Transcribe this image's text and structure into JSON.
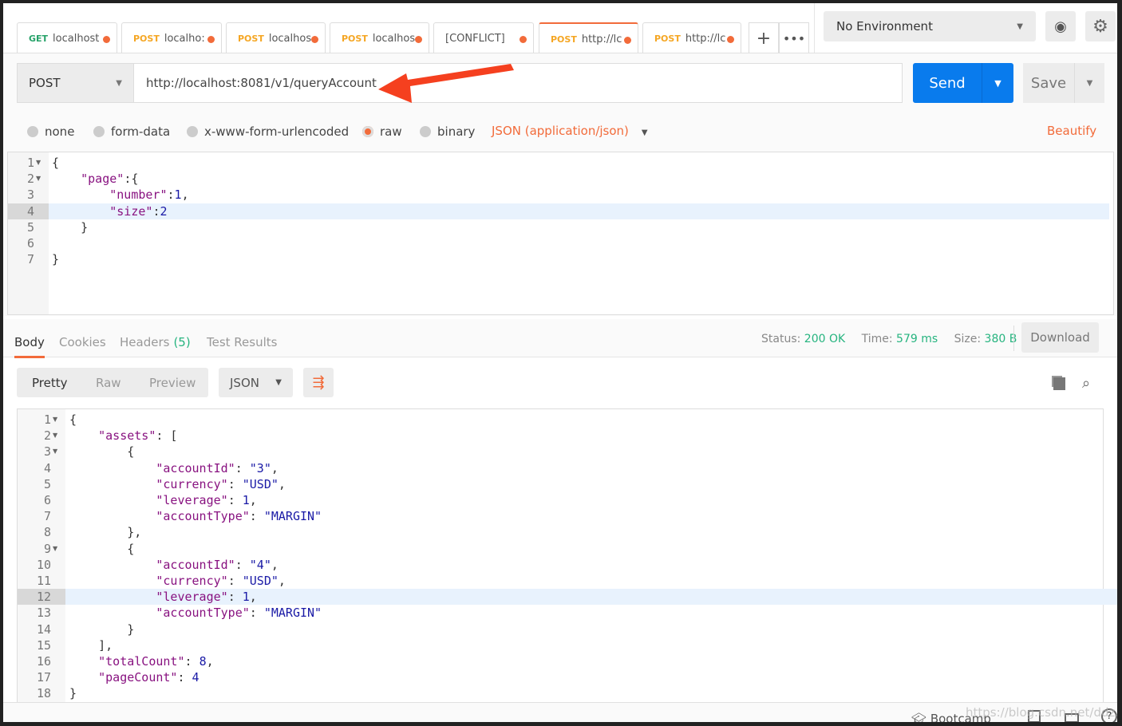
{
  "tabs": [
    {
      "method": "GET",
      "label": "localhost",
      "active": false
    },
    {
      "method": "POST",
      "label": "localho:",
      "active": false
    },
    {
      "method": "POST",
      "label": "localhos",
      "active": false
    },
    {
      "method": "POST",
      "label": "localhos",
      "active": false
    },
    {
      "method": "",
      "label": "[CONFLICT] PC",
      "active": false
    },
    {
      "method": "POST",
      "label": "http://lc",
      "active": true
    },
    {
      "method": "POST",
      "label": "http://lc",
      "active": false
    }
  ],
  "environment": "No Environment",
  "request": {
    "method": "POST",
    "url": "http://localhost:8081/v1/queryAccount",
    "send": "Send",
    "save": "Save"
  },
  "body_options": [
    "none",
    "form-data",
    "x-www-form-urlencoded",
    "raw",
    "binary"
  ],
  "body_selected": "raw",
  "content_type": "JSON (application/json)",
  "beautify": "Beautify",
  "request_body": [
    "{",
    "    \"page\":{",
    "        \"number\":1,",
    "        \"size\":2",
    "    }",
    "",
    "}"
  ],
  "request_active_line": 4,
  "response_tabs": [
    "Body",
    "Cookies",
    "Headers",
    "Test Results"
  ],
  "headers_count": "(5)",
  "status": {
    "status_label": "Status:",
    "status": "200 OK",
    "time_label": "Time:",
    "time": "579 ms",
    "size_label": "Size:",
    "size": "380 B"
  },
  "download": "Download",
  "view_modes": [
    "Pretty",
    "Raw",
    "Preview"
  ],
  "format": "JSON",
  "response_body": [
    "{",
    "    \"assets\": [",
    "        {",
    "            \"accountId\": \"3\",",
    "            \"currency\": \"USD\",",
    "            \"leverage\": 1,",
    "            \"accountType\": \"MARGIN\"",
    "        },",
    "        {",
    "            \"accountId\": \"4\",",
    "            \"currency\": \"USD\",",
    "            \"leverage\": 1,",
    "            \"accountType\": \"MARGIN\"",
    "        }",
    "    ],",
    "    \"totalCount\": 8,",
    "    \"pageCount\": 4",
    "}"
  ],
  "response_active_line": 12,
  "footer": {
    "bootcamp": "Bootcamp",
    "watermark": "https://blog.csdn.net/ddz..."
  },
  "colors": {
    "accent": "#f26b3a",
    "send": "#097bed",
    "status": "#26b47f",
    "key": "#881280",
    "value": "#1a1aa6"
  }
}
